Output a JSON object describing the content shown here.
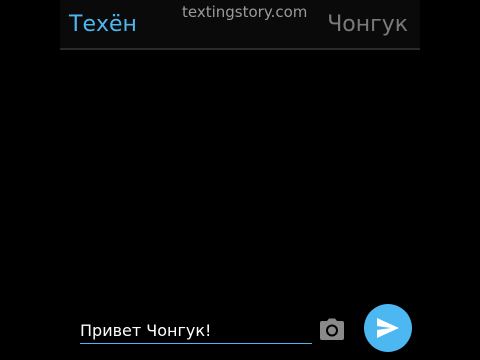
{
  "header": {
    "contact_left": "Техён",
    "contact_right": "Чонгук",
    "watermark": "textingstory.com"
  },
  "composer": {
    "message_text": "Привет Чонгук!"
  },
  "icons": {
    "camera": "camera-icon",
    "send": "send-icon"
  },
  "colors": {
    "accent": "#4cb7f0",
    "background": "#000000",
    "muted_text": "#7a7a7a"
  }
}
